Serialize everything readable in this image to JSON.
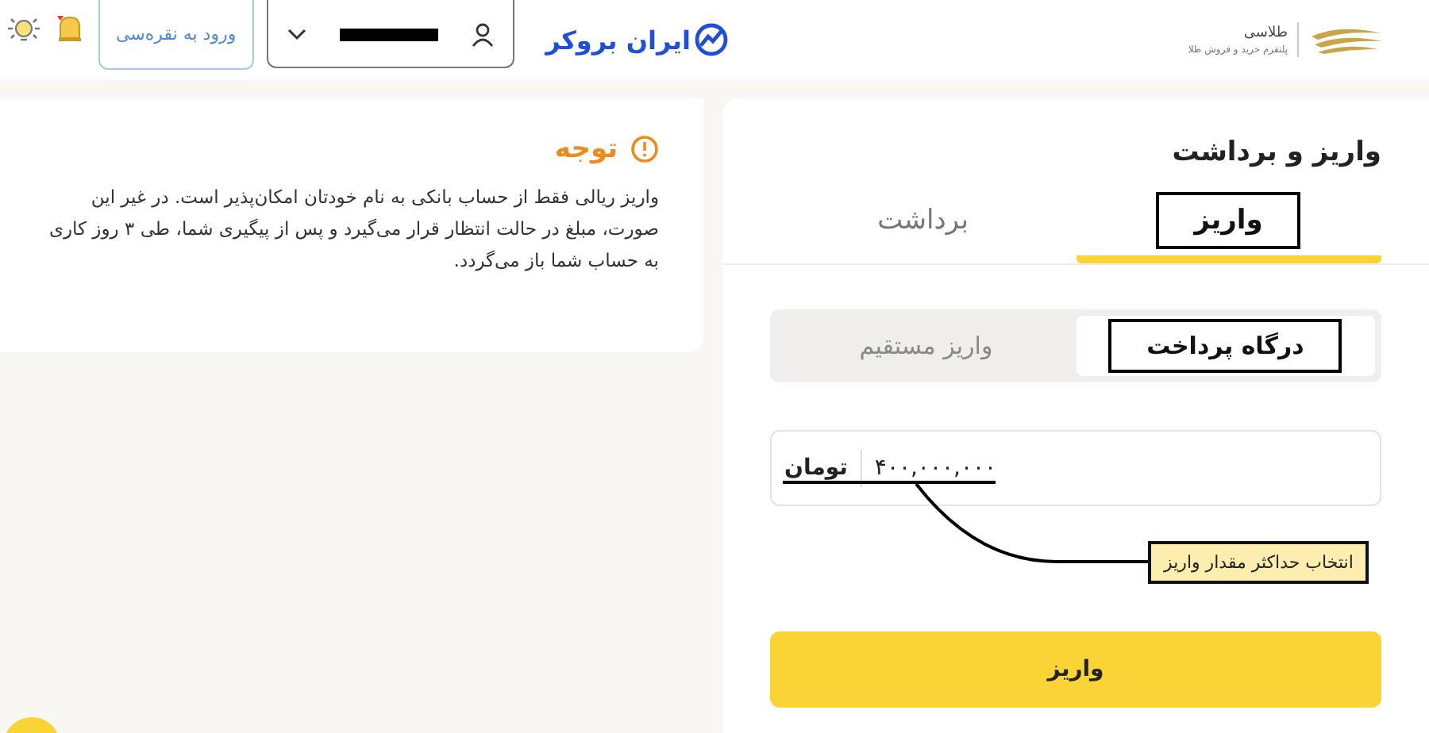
{
  "header": {
    "logo_title": "طلاسی",
    "logo_subtitle": "پلتفرم خرید و فروش طلا",
    "brand": "ایران بروکر",
    "login_button": "ورود به نقره‌سی"
  },
  "notice": {
    "title": "توجه",
    "text": "واریز ریالی فقط از حساب بانکی به نام خودتان امکان‌پذیر است. در غیر این صورت، مبلغ در حالت انتظار قرار می‌گیرد و پس از پیگیری شما، طی ۳ روز کاری به حساب شما باز می‌گردد."
  },
  "panel": {
    "title": "واریز و برداشت",
    "tabs": [
      {
        "label": "واریز",
        "selected": true,
        "highlighted": true
      },
      {
        "label": "برداشت",
        "selected": false,
        "highlighted": false
      }
    ],
    "methods": [
      {
        "label": "درگاه پرداخت",
        "selected": true,
        "highlighted": true
      },
      {
        "label": "واریز مستقیم",
        "selected": false,
        "highlighted": false
      }
    ],
    "amount": {
      "value": "۴۰۰,۰۰۰,۰۰۰",
      "unit": "تومان"
    },
    "callout": "انتخاب حداکثر مقدار واریز",
    "submit": "واریز"
  }
}
